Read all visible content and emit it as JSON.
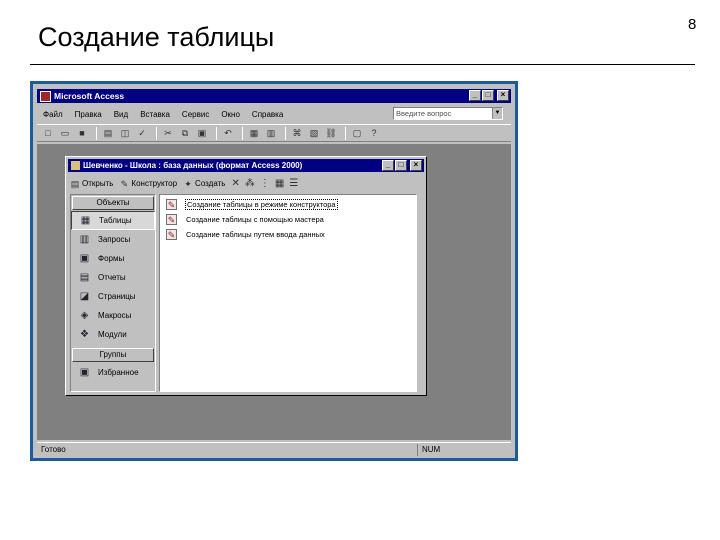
{
  "slide": {
    "title": "Создание таблицы",
    "page_number": "8"
  },
  "app": {
    "title": "Microsoft Access",
    "menu": [
      "Файл",
      "Правка",
      "Вид",
      "Вставка",
      "Сервис",
      "Окно",
      "Справка"
    ],
    "help_placeholder": "Введите вопрос",
    "status_text": "Готово",
    "status_num": "NUM"
  },
  "db_window": {
    "title": "Шевченко - Школа : база данных (формат Access 2000)",
    "toolbar": {
      "open": "Открыть",
      "design": "Конструктор",
      "create": "Создать"
    },
    "objects_header": "Объекты",
    "objects": [
      {
        "label": "Таблицы",
        "icon": "table-icon",
        "selected": true
      },
      {
        "label": "Запросы",
        "icon": "query-icon",
        "selected": false
      },
      {
        "label": "Формы",
        "icon": "form-icon",
        "selected": false
      },
      {
        "label": "Отчеты",
        "icon": "report-icon",
        "selected": false
      },
      {
        "label": "Страницы",
        "icon": "page-icon",
        "selected": false
      },
      {
        "label": "Макросы",
        "icon": "macro-icon",
        "selected": false
      },
      {
        "label": "Модули",
        "icon": "module-icon",
        "selected": false
      }
    ],
    "groups_header": "Группы",
    "groups": [
      {
        "label": "Избранное",
        "icon": "favorites-icon"
      }
    ],
    "list": [
      {
        "label": "Создание таблицы в режиме конструктора",
        "selected": true
      },
      {
        "label": "Создание таблицы с помощью мастера",
        "selected": false
      },
      {
        "label": "Создание таблицы путем ввода данных",
        "selected": false
      }
    ]
  }
}
